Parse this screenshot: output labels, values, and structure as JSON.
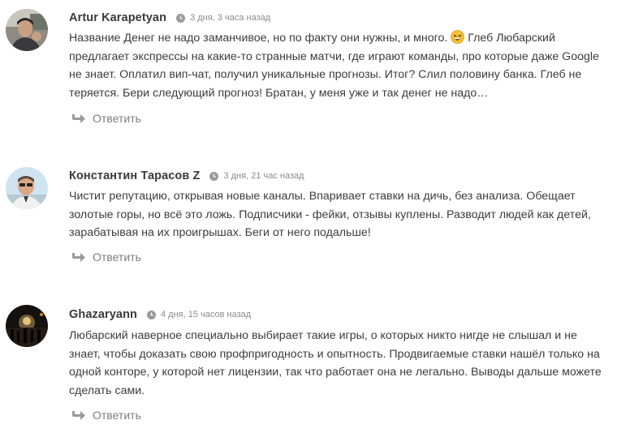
{
  "reply_label": "Ответить",
  "comments": [
    {
      "author": "Artur Karapetyan",
      "time": "3 дня, 3 часа назад",
      "avatar_icon": "avatar-man-in-car",
      "lines": [
        "Название Денег не надо заманчивое, но по факту они нужны, и много.",
        "предлагает экспрессы на какие-то странные матчи, где играют команды, про которые даже Google",
        "не знает. Оплатил вип-чат, получил уникальные прогнозы. Итог? Слил половину банка. Глеб не",
        "теряется. Бери следующий прогноз! Братан, у меня уже и так денег не надо…"
      ],
      "line1_tail": "Глеб Любарский",
      "emoji": "grinning-sweat-emoji"
    },
    {
      "author": "Константин Тарасов Z",
      "time": "3 дня, 21 час назад",
      "avatar_icon": "avatar-man-in-glasses",
      "lines": [
        "Чистит репутацию, открывая новые каналы. Впаривает ставки на дичь, без анализа. Обещает",
        "золотые горы, но всё это ложь. Подписчики - фейки, отзывы куплены. Разводит людей как детей,",
        "зарабатывая на их проигрышах. Беги от него подальше!"
      ]
    },
    {
      "author": "Ghazaryann",
      "time": "4 дня, 15 часов назад",
      "avatar_icon": "avatar-night-street",
      "lines": [
        "Любарский наверное специально выбирает такие игры, о которых никто нигде не слышал и не",
        "знает, чтобы доказать свою профпригодность и опытность. Продвигаемые ставки нашёл только на",
        "одной конторе, у которой нет лицензии, так что работает она не легально. Выводы дальше можете",
        "сделать сами."
      ]
    }
  ],
  "colors": {
    "text": "#3c3c3c",
    "muted": "#8a8a8a",
    "reply": "#7d7d7d",
    "icon": "#9a9a9a"
  }
}
